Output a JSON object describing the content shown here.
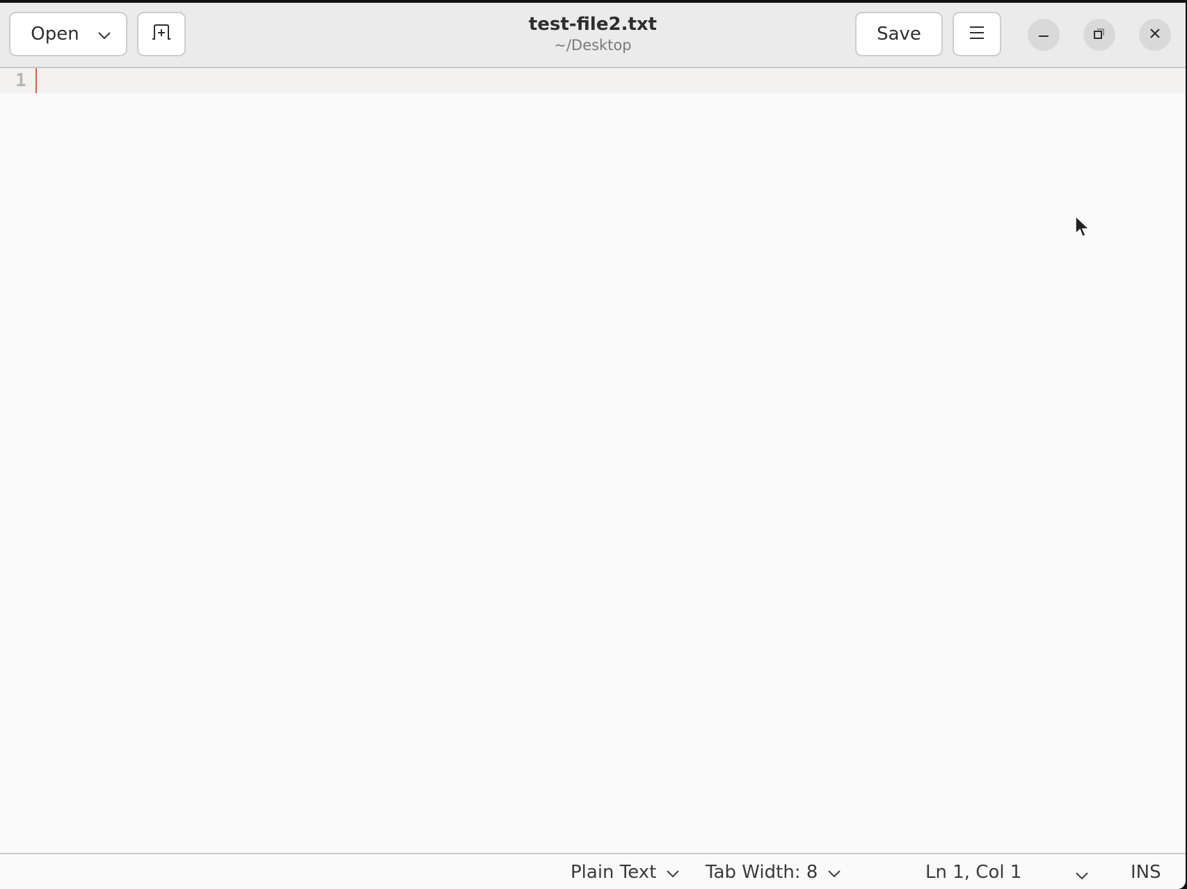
{
  "window": {
    "title": "test-file2.txt",
    "subtitle": "~/Desktop"
  },
  "headerbar": {
    "open_label": "Open",
    "open_icon": "chevron-down-icon",
    "new_tab_icon": "new-tab-icon",
    "save_label": "Save",
    "menu_icon": "hamburger-menu-icon",
    "window_controls": [
      "minimize-icon",
      "restore-icon",
      "close-icon"
    ]
  },
  "editor": {
    "line_numbers": [
      "1"
    ],
    "content": "",
    "caret_color": "#e0603a"
  },
  "statusbar": {
    "language": "Plain Text",
    "tab_width": "Tab Width: 8",
    "position": "Ln 1, Col 1",
    "mode": "INS"
  }
}
